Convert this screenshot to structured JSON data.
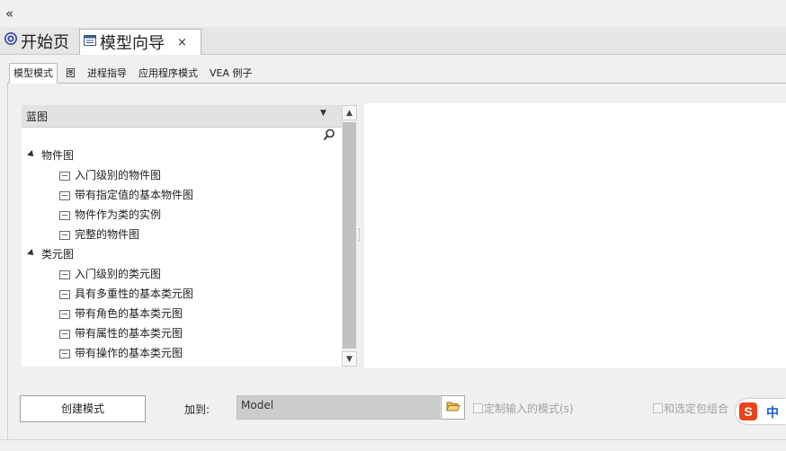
{
  "collapse_glyph": "«",
  "doc_tabs": [
    {
      "label": "开始页",
      "icon": "start-page-icon"
    },
    {
      "label": "模型向导",
      "icon": "wizard-icon",
      "close_glyph": "×"
    }
  ],
  "inner_tabs": [
    "模型模式",
    "图",
    "进程指导",
    "应用程序模式",
    "VEA 例子"
  ],
  "active_inner_tab": 0,
  "combo": {
    "value": "蓝图"
  },
  "tree": [
    {
      "label": "物件图",
      "expanded": true,
      "children": [
        "入门级别的物件图",
        "带有指定值的基本物件图",
        "物件作为类的实例",
        "完整的物件图"
      ]
    },
    {
      "label": "类元图",
      "expanded": true,
      "children": [
        "入门级别的类元图",
        "具有多重性的基本类元图",
        "带有角色的基本类元图",
        "带有属性的基本类元图",
        "带有操作的基本类元图"
      ]
    }
  ],
  "bottom": {
    "create_button": "创建模式",
    "add_to_label": "加到:",
    "add_to_value": "Model",
    "checkbox_custom": "定制输入的模式(s)",
    "checkbox_package": "和选定包组合"
  },
  "ime": {
    "logo": "S",
    "mode": "中"
  },
  "colors": {
    "preview_bg": "#ffffff",
    "ime_logo": "#e8451c",
    "ime_mode": "#1a5fc4"
  }
}
